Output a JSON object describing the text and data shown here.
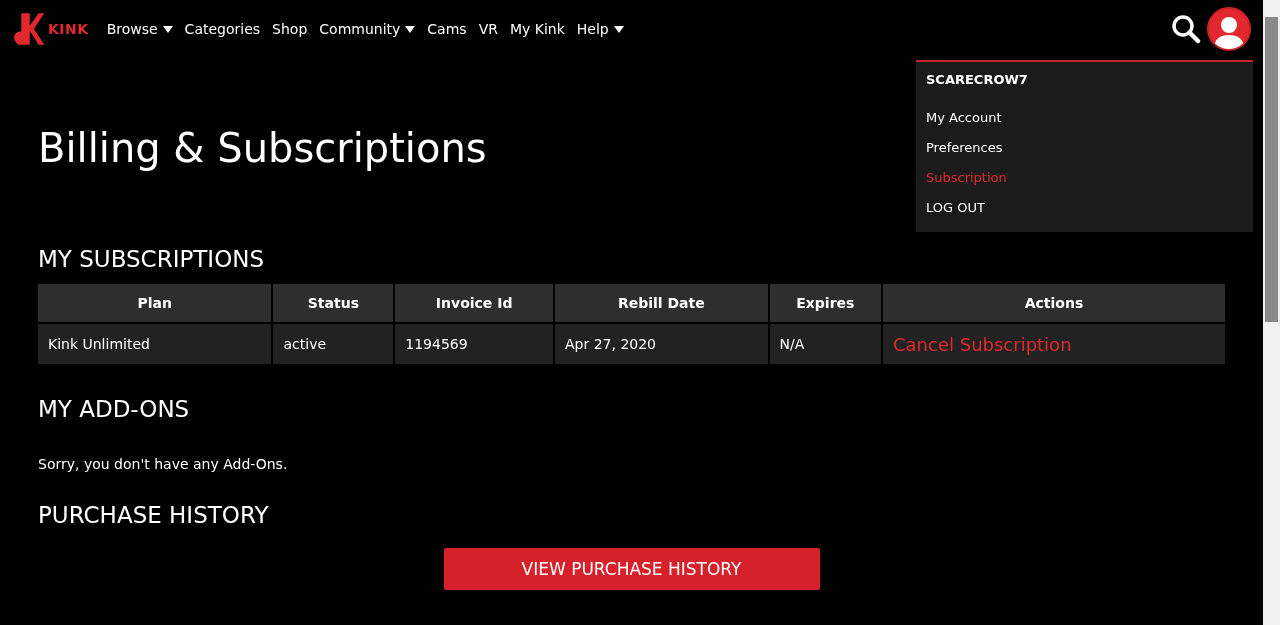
{
  "logo": {
    "text": "KINK"
  },
  "nav": [
    {
      "label": "Browse",
      "dropdown": true
    },
    {
      "label": "Categories",
      "dropdown": false
    },
    {
      "label": "Shop",
      "dropdown": false
    },
    {
      "label": "Community",
      "dropdown": true
    },
    {
      "label": "Cams",
      "dropdown": false
    },
    {
      "label": "VR",
      "dropdown": false
    },
    {
      "label": "My Kink",
      "dropdown": false
    },
    {
      "label": "Help",
      "dropdown": true
    }
  ],
  "user_menu": {
    "username": "SCARECROW7",
    "items": [
      {
        "label": "My Account",
        "selected": false
      },
      {
        "label": "Preferences",
        "selected": false
      },
      {
        "label": "Subscription",
        "selected": true
      },
      {
        "label": "LOG OUT",
        "selected": false
      }
    ]
  },
  "page_title": "Billing & Subscriptions",
  "subscriptions": {
    "heading": "MY SUBSCRIPTIONS",
    "columns": [
      "Plan",
      "Status",
      "Invoice Id",
      "Rebill Date",
      "Expires",
      "Actions"
    ],
    "rows": [
      {
        "plan": "Kink Unlimited",
        "status": "active",
        "invoice_id": "1194569",
        "rebill_date": "Apr 27, 2020",
        "expires": "N/A",
        "action": "Cancel Subscription"
      }
    ]
  },
  "addons": {
    "heading": "MY ADD-ONS",
    "message": "Sorry, you don't have any Add-Ons."
  },
  "purchase_history": {
    "heading": "PURCHASE HISTORY",
    "button": "VIEW PURCHASE HISTORY"
  }
}
